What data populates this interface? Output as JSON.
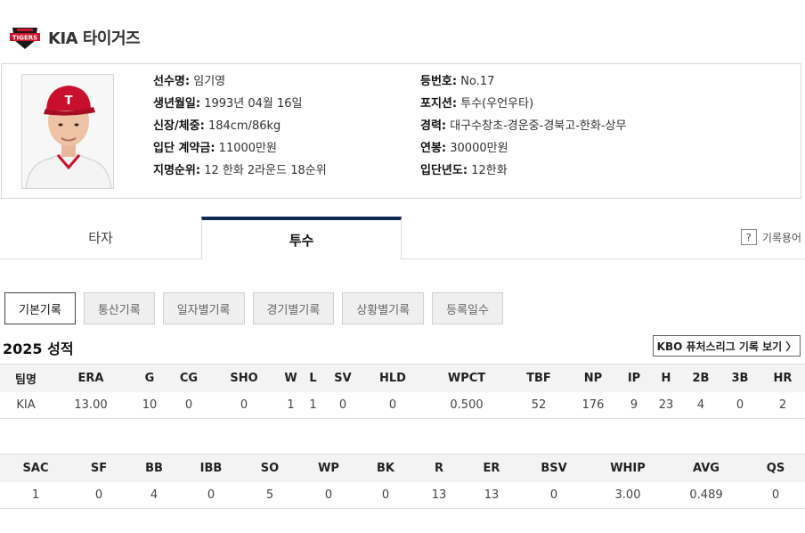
{
  "team": {
    "name": "KIA 타이거즈",
    "logo_text": "TIGERS"
  },
  "profile": {
    "left": [
      {
        "label": "선수명:",
        "value": "임기영"
      },
      {
        "label": "생년월일:",
        "value": "1993년 04월 16일"
      },
      {
        "label": "신장/체중:",
        "value": "184cm/86kg"
      },
      {
        "label": "입단 계약금:",
        "value": "11000만원"
      },
      {
        "label": "지명순위:",
        "value": "12 한화 2라운드 18순위"
      }
    ],
    "right": [
      {
        "label": "등번호:",
        "value": "No.17"
      },
      {
        "label": "포지션:",
        "value": "투수(우언우타)"
      },
      {
        "label": "경력:",
        "value": "대구수창초-경운중-경북고-한화-상무"
      },
      {
        "label": "연봉:",
        "value": "30000만원"
      },
      {
        "label": "입단년도:",
        "value": "12한화"
      }
    ]
  },
  "tabs": {
    "batter": "타자",
    "pitcher": "투수",
    "glossary_icon": "?",
    "glossary": "기록용어"
  },
  "subtabs": [
    "기본기록",
    "통산기록",
    "일자별기록",
    "경기별기록",
    "상황별기록",
    "등록일수"
  ],
  "season_title": "2025 성적",
  "futures_link": "KBO 퓨처스리그 기록 보기 〉",
  "table1": {
    "headers": [
      "팀명",
      "ERA",
      "G",
      "CG",
      "SHO",
      "W",
      "L",
      "SV",
      "HLD",
      "WPCT",
      "TBF",
      "NP",
      "IP",
      "H",
      "2B",
      "3B",
      "HR"
    ],
    "row": [
      "KIA",
      "13.00",
      "10",
      "0",
      "0",
      "1",
      "1",
      "0",
      "0",
      "0.500",
      "52",
      "176",
      "9",
      "23",
      "4",
      "0",
      "2"
    ]
  },
  "table2": {
    "headers": [
      "SAC",
      "SF",
      "BB",
      "IBB",
      "SO",
      "WP",
      "BK",
      "R",
      "ER",
      "BSV",
      "WHIP",
      "AVG",
      "QS"
    ],
    "row": [
      "1",
      "0",
      "4",
      "0",
      "5",
      "0",
      "0",
      "13",
      "13",
      "0",
      "3.00",
      "0.489",
      "0"
    ]
  },
  "colors": {
    "tab_accent": "#0e2a53",
    "logo_red": "#d0112b",
    "logo_dark": "#1a1a1a"
  }
}
